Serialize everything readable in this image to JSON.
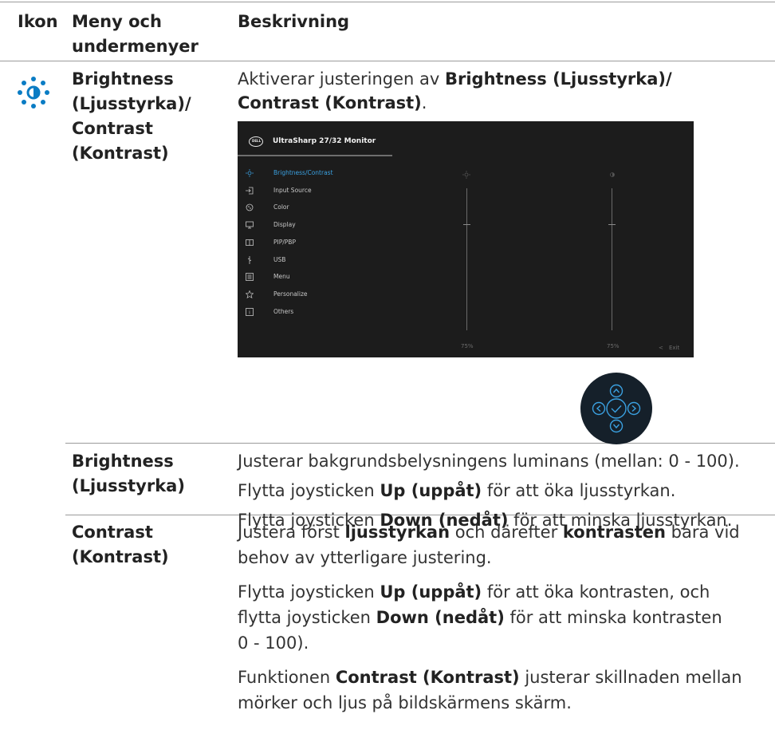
{
  "header": {
    "col_icon": "Ikon",
    "col_menu_line1": "Meny och",
    "col_menu_line2": "undermenyer",
    "col_desc": "Beskrivning"
  },
  "row_main": {
    "icon": "brightness-sun-icon",
    "title_lines": [
      "Brightness",
      "(Ljusstyrka)/",
      "Contrast",
      "(Kontrast)"
    ],
    "desc": {
      "pre": "Aktiverar justeringen av ",
      "bold1": "Brightness (Ljusstyrka)/",
      "bold2": "Contrast (Kontrast)",
      "post": "."
    }
  },
  "osd": {
    "brand": "DELL",
    "title": "UltraSharp 27/32 Monitor",
    "menu": [
      {
        "label": "Brightness/Contrast",
        "icon": "sun-icon",
        "active": true
      },
      {
        "label": "Input Source",
        "icon": "input-icon",
        "active": false
      },
      {
        "label": "Color",
        "icon": "palette-icon",
        "active": false
      },
      {
        "label": "Display",
        "icon": "display-icon",
        "active": false
      },
      {
        "label": "PIP/PBP",
        "icon": "pip-icon",
        "active": false
      },
      {
        "label": "USB",
        "icon": "usb-icon",
        "active": false
      },
      {
        "label": "Menu",
        "icon": "menu-icon",
        "active": false
      },
      {
        "label": "Personalize",
        "icon": "star-icon",
        "active": false
      },
      {
        "label": "Others",
        "icon": "others-icon",
        "active": false
      }
    ],
    "brightness_value": "75%",
    "contrast_value": "75%",
    "brightness_level": 75,
    "contrast_level": 75,
    "exit_label": "Exit",
    "accent": "#3aa0e0"
  },
  "joystick": {
    "icons": [
      "up-arrow-icon",
      "left-arrow-icon",
      "check-icon",
      "right-arrow-icon",
      "down-arrow-icon"
    ],
    "accent": "#3aa0e0"
  },
  "row_brightness": {
    "title_lines": [
      "Brightness",
      "(Ljusstyrka)"
    ],
    "line1": "Justerar bakgrundsbelysningens luminans (mellan: 0 - 100).",
    "line2": {
      "pre": "Flytta joysticken ",
      "bold": "Up (uppåt)",
      "post": " för att öka ljusstyrkan."
    },
    "line3": {
      "pre": "Flytta joysticken ",
      "bold": "Down (nedåt)",
      "post": " för att minska ljusstyrkan."
    }
  },
  "row_contrast": {
    "title_lines": [
      "Contrast",
      "(Kontrast)"
    ],
    "p1": {
      "pre": "Justera först ",
      "bold1": "ljusstyrkan",
      "mid": " och därefter ",
      "bold2": "kontrasten",
      "post": " bara vid",
      "line2": "behov av ytterligare justering."
    },
    "p2": {
      "l1_pre": "Flytta joysticken ",
      "l1_bold": "Up (uppåt)",
      "l1_post": " för att öka kontrasten, och",
      "l2_pre": "flytta joysticken ",
      "l2_bold": "Down (nedåt)",
      "l2_post": " för att minska kontrasten",
      "l3": "0 - 100)."
    },
    "p3": {
      "pre": "Funktionen ",
      "bold": "Contrast (Kontrast)",
      "post": " justerar skillnaden mellan",
      "line2": "mörker och ljus på bildskärmens skärm."
    }
  }
}
